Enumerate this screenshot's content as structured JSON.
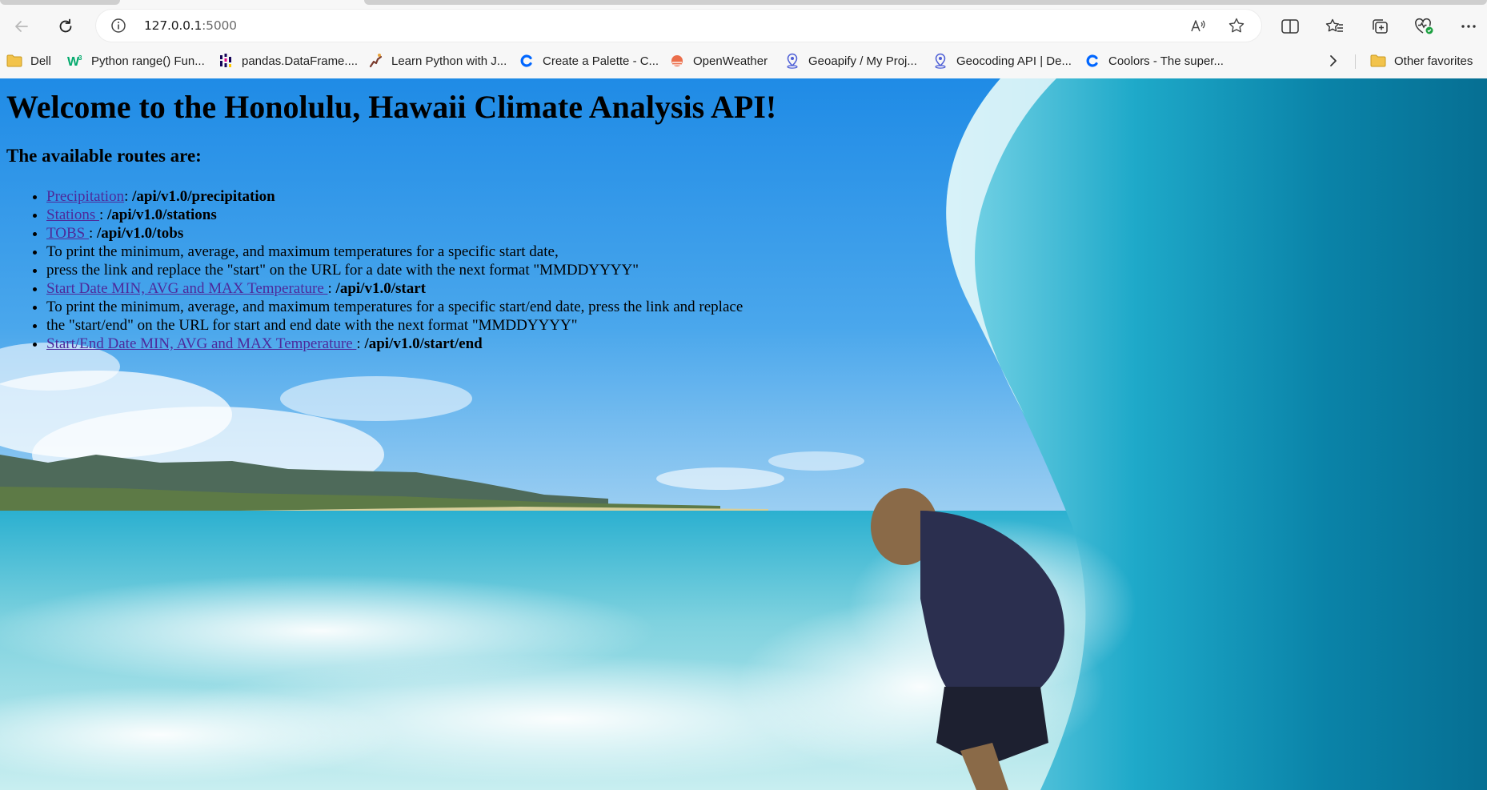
{
  "browser": {
    "url_host": "127.0.0.1",
    "url_port": ":5000",
    "favorites": [
      {
        "label": "Dell",
        "icon": "folder-icon"
      },
      {
        "label": "Python range() Fun...",
        "icon": "w3schools-icon"
      },
      {
        "label": "pandas.DataFrame....",
        "icon": "pandas-icon"
      },
      {
        "label": "Learn Python with J...",
        "icon": "python-runner-icon"
      },
      {
        "label": "Create a Palette - C...",
        "icon": "coolors-icon"
      },
      {
        "label": "OpenWeather",
        "icon": "openweather-icon"
      },
      {
        "label": "Geoapify / My Proj...",
        "icon": "geoapify-icon"
      },
      {
        "label": "Geocoding API | De...",
        "icon": "geoapify-icon"
      },
      {
        "label": "Coolors - The super...",
        "icon": "coolors-icon"
      }
    ],
    "other_favorites": "Other favorites",
    "link_color": "#4d2a9b"
  },
  "page": {
    "title": "Welcome to the Honolulu, Hawaii Climate Analysis API!",
    "subtitle": "The available routes are:",
    "routes": {
      "precipitation": {
        "link": "Precipitation",
        "sep": ": ",
        "path": "/api/v1.0/precipitation"
      },
      "stations": {
        "link": "Stations ",
        "sep": ": ",
        "path": "/api/v1.0/stations"
      },
      "tobs": {
        "link": "TOBS ",
        "sep": ": ",
        "path": "/api/v1.0/tobs"
      },
      "note_start_1": "To print the minimum, average, and maximum temperatures for a specific start date,",
      "note_start_2": "press the link and replace the \"start\" on the URL for a date with the next format \"MMDDYYYY\"",
      "start": {
        "link": "Start Date MIN, AVG and MAX Temperature ",
        "sep": ": ",
        "path": "/api/v1.0/start"
      },
      "note_range_1": "To print the minimum, average, and maximum temperatures for a specific start/end date, press the link and replace",
      "note_range_2": "the \"start/end\" on the URL for start and end date with the next format \"MMDDYYYY\"",
      "start_end": {
        "link": "Start/End Date MIN, AVG and MAX Temperature ",
        "sep": ": ",
        "path": "/api/v1.0/start/end"
      }
    }
  }
}
